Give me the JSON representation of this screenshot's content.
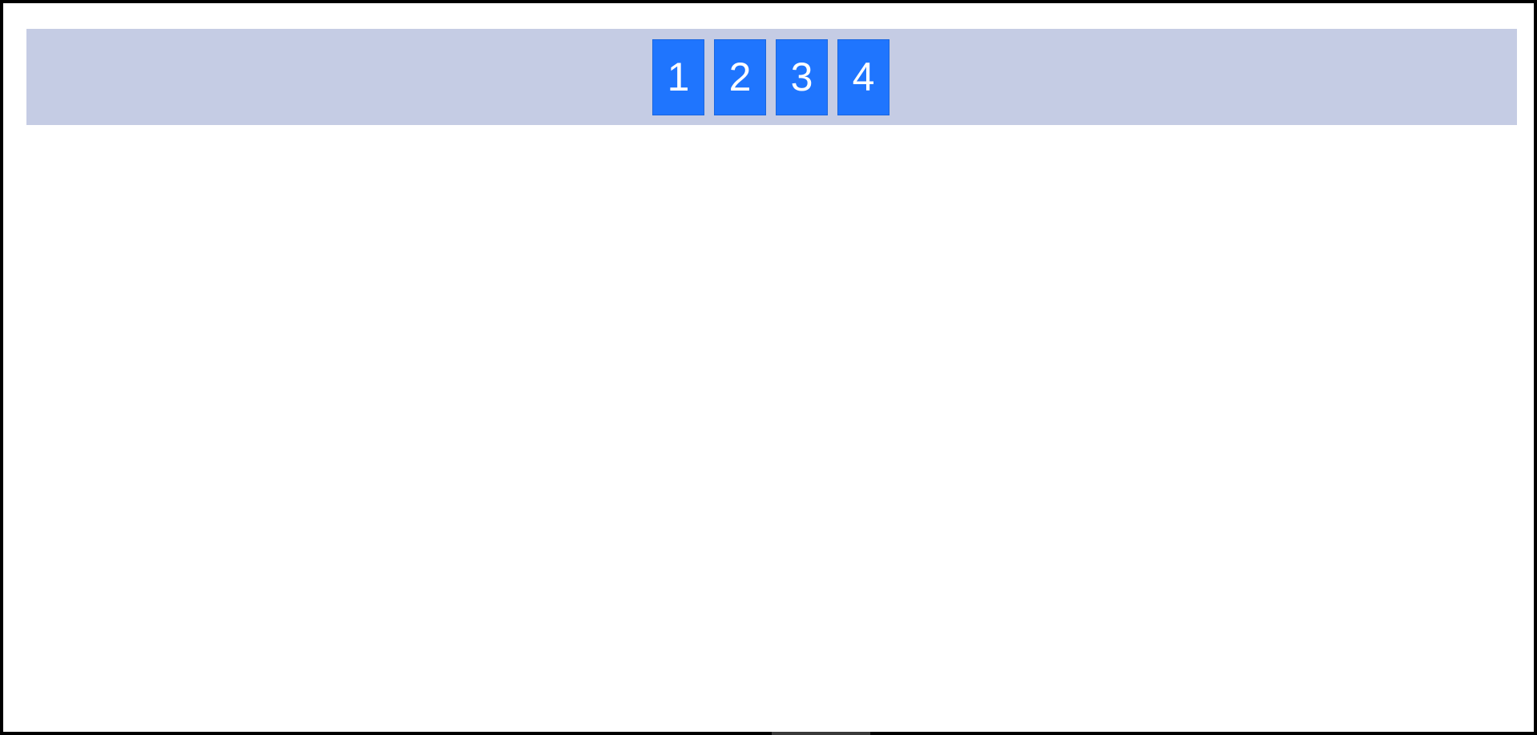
{
  "toolbar": {
    "background_color": "#c5cce4",
    "button_color": "#1f75fe",
    "buttons": [
      {
        "label": "1"
      },
      {
        "label": "2"
      },
      {
        "label": "3"
      },
      {
        "label": "4"
      }
    ]
  }
}
